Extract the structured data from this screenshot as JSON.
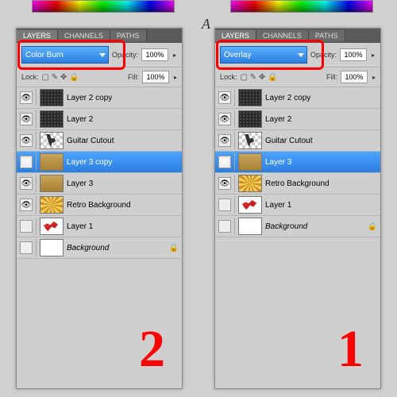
{
  "panels": [
    {
      "id": "left",
      "blendMode": "Color Burn",
      "tabs": [
        "LAYERS",
        "CHANNELS",
        "PATHS"
      ],
      "opacityLabel": "Opacity:",
      "opacityValue": "100%",
      "lockLabel": "Lock:",
      "fillLabel": "Fill:",
      "fillValue": "100%",
      "bigNumber": "2",
      "layers": [
        {
          "name": "Layer 2 copy",
          "thumb": "dark",
          "visible": true
        },
        {
          "name": "Layer 2",
          "thumb": "dark",
          "visible": true
        },
        {
          "name": "Guitar Cutout",
          "thumb": "checker",
          "visible": true
        },
        {
          "name": "Layer 3 copy",
          "thumb": "wood",
          "visible": true,
          "selected": true
        },
        {
          "name": "Layer 3",
          "thumb": "wood",
          "visible": true
        },
        {
          "name": "Retro Background",
          "thumb": "retro",
          "visible": true
        },
        {
          "name": "Layer 1",
          "thumb": "guit",
          "visible": false
        },
        {
          "name": "Background",
          "thumb": "white",
          "visible": false,
          "italic": true,
          "locked": true
        }
      ]
    },
    {
      "id": "right",
      "blendMode": "Overlay",
      "tabs": [
        "LAYERS",
        "CHANNELS",
        "PATHS"
      ],
      "opacityLabel": "Opacity:",
      "opacityValue": "100%",
      "lockLabel": "Lock:",
      "fillLabel": "Fill:",
      "fillValue": "100%",
      "bigNumber": "1",
      "aSymbol": "A",
      "layers": [
        {
          "name": "Layer 2 copy",
          "thumb": "dark",
          "visible": true
        },
        {
          "name": "Layer 2",
          "thumb": "dark",
          "visible": true
        },
        {
          "name": "Guitar Cutout",
          "thumb": "checker",
          "visible": true
        },
        {
          "name": "Layer 3",
          "thumb": "wood",
          "visible": true,
          "selected": true
        },
        {
          "name": "Retro Background",
          "thumb": "retro",
          "visible": true
        },
        {
          "name": "Layer 1",
          "thumb": "guit",
          "visible": false
        },
        {
          "name": "Background",
          "thumb": "white",
          "visible": false,
          "italic": true,
          "locked": true
        }
      ]
    }
  ]
}
